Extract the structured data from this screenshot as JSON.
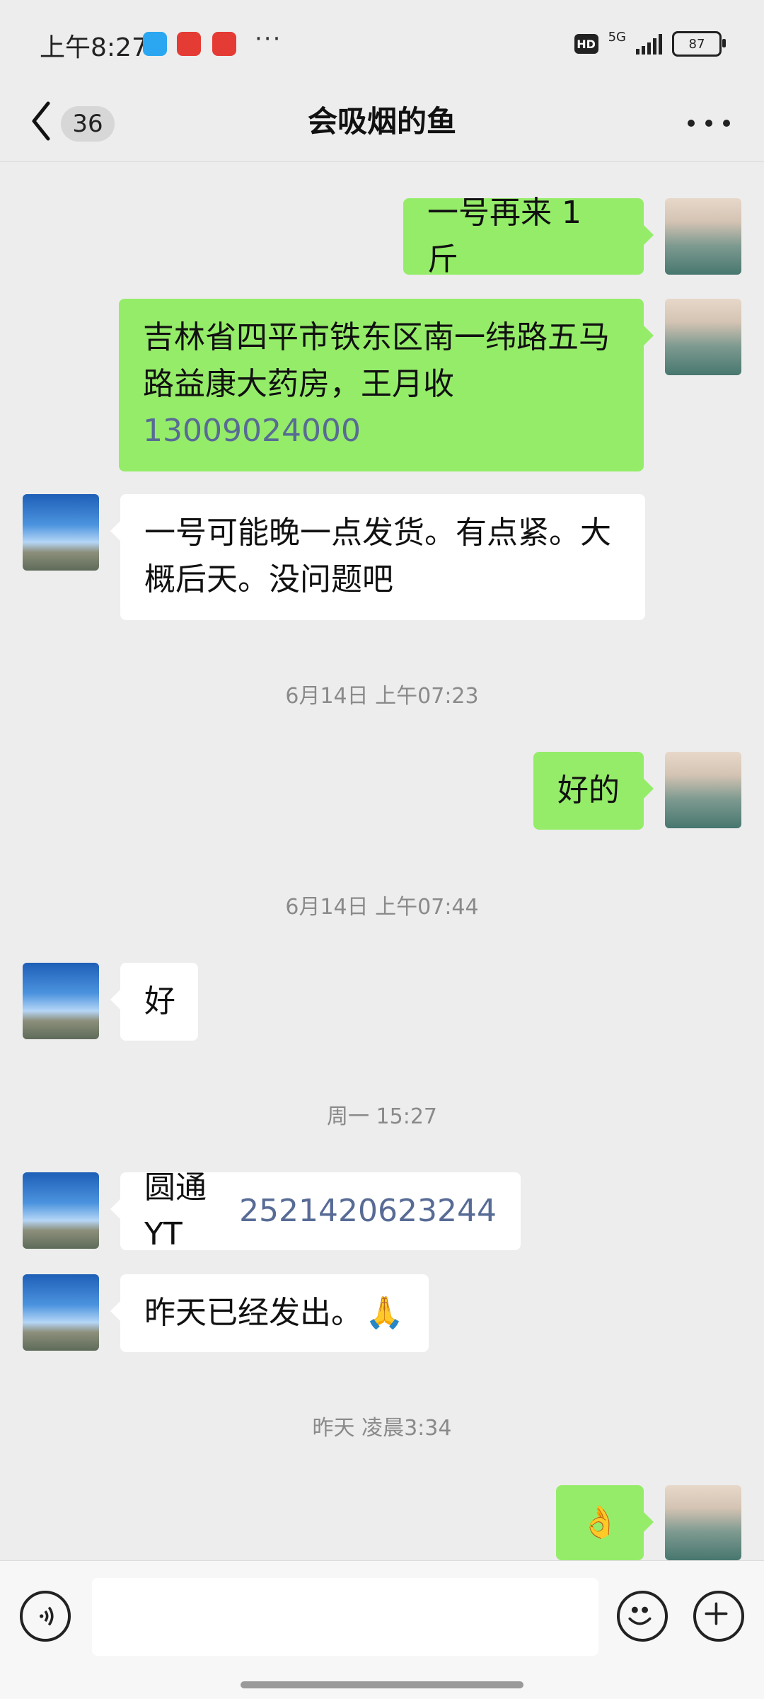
{
  "status_bar": {
    "time": "上午8:27",
    "app_icons": [
      {
        "name": "browser-app-icon",
        "color": "#1e90ff"
      },
      {
        "name": "kandian-app-icon",
        "color": "#e53b35"
      },
      {
        "name": "toutiao-app-icon",
        "color": "#e53b35"
      }
    ],
    "more": "···",
    "hd": "HD",
    "network": "5G",
    "battery": "87"
  },
  "header": {
    "unread_count": "36",
    "title": "会吸烟的鱼"
  },
  "messages": [
    {
      "side": "sent",
      "text": "一号再来 1 斤"
    },
    {
      "side": "sent",
      "text_lines": [
        "吉林省四平市铁东区南一纬路五马",
        "路益康大药房，王月收"
      ],
      "phone": "13009024000"
    },
    {
      "side": "received",
      "text_lines": [
        "一号可能晚一点发货。有点紧。大",
        "概后天。没问题吧"
      ]
    },
    {
      "side": "sent",
      "text": "好的"
    },
    {
      "side": "received",
      "text": "好"
    },
    {
      "side": "received",
      "prefix": "圆通 YT",
      "tracking": "2521420623244"
    },
    {
      "side": "received",
      "text": "昨天已经发出。",
      "emoji": "🙏"
    },
    {
      "side": "sent",
      "emoji": "👌"
    }
  ],
  "time_separators": [
    "6月14日 上午07:23",
    "6月14日 上午07:44",
    "周一 15:27",
    "昨天 凌晨3:34"
  ],
  "input": {
    "placeholder": ""
  },
  "colors": {
    "sent_bubble": "#95ec69",
    "received_bubble": "#ffffff",
    "background": "#ededed",
    "link": "#576b95"
  }
}
